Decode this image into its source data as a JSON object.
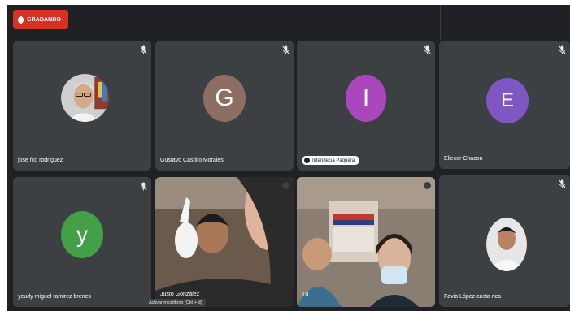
{
  "recording": {
    "label": "GRABANDO",
    "color": "#d93025"
  },
  "participants": [
    {
      "name": "jose fco rodriguez",
      "type": "photo",
      "muted": true
    },
    {
      "name": "Gustavo Castillo Morales",
      "type": "letter",
      "letter": "G",
      "color": "#8d6e63",
      "muted": true
    },
    {
      "name": "Intendecia Paquera",
      "type": "letter",
      "letter": "I",
      "color": "#ab47bc",
      "muted": true,
      "pinned_chip": true
    },
    {
      "name": "Eliecer Chacon",
      "type": "letter",
      "letter": "E",
      "color": "#7e57c2",
      "muted": true
    },
    {
      "name": "yeudy miguel ramirez brenes",
      "type": "letter",
      "letter": "y",
      "color": "#43a047",
      "muted": true
    },
    {
      "name": "Justo González",
      "type": "video",
      "muted": true
    },
    {
      "name": "Tú",
      "type": "video",
      "muted": true
    },
    {
      "name": "Favio López costa rica",
      "type": "photo",
      "muted": true
    }
  ],
  "tooltip": {
    "text": "Activar micrófono (Ctrl + d)"
  },
  "icons": {
    "mic_off": "mic-off-icon",
    "record": "record-dot-icon",
    "chip": "presentation-icon"
  }
}
